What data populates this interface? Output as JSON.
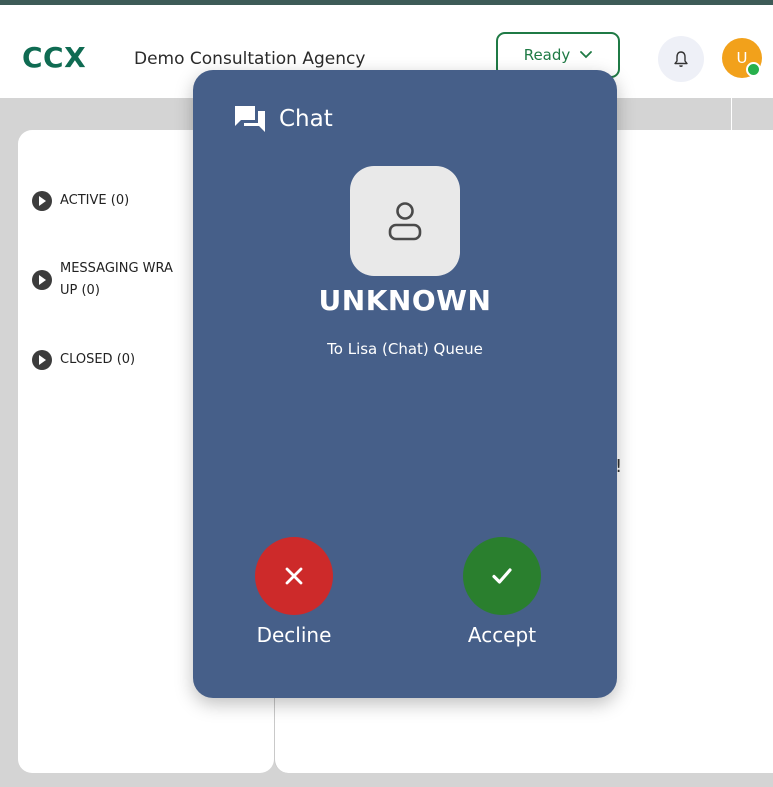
{
  "header": {
    "logo": "CCX",
    "agency_name": "Demo Consultation Agency",
    "status": {
      "label": "Ready",
      "icon": "chevron-down-icon"
    },
    "notifications_icon": "bell-icon",
    "avatar_initial": "U",
    "colors": {
      "logo": "#0f6b52",
      "status": "#1f7a45",
      "avatar": "#f2a11b",
      "presence": "#27b04c"
    }
  },
  "sidebar": {
    "items": [
      {
        "label": "ACTIVE (0)"
      },
      {
        "label": "MESSAGING WRA",
        "label2": "UP (0)"
      },
      {
        "label": "CLOSED (0)"
      }
    ]
  },
  "main": {
    "partial_text": "!"
  },
  "incoming": {
    "title": "Chat",
    "title_icon": "chat-bubbles-icon",
    "avatar_icon": "person-icon",
    "caller": "UNKNOWN",
    "queue": "To Lisa (Chat) Queue",
    "decline_label": "Decline",
    "accept_label": "Accept",
    "colors": {
      "modal": "#465f89",
      "decline": "#cd2a2a",
      "accept": "#2a7f2e"
    }
  }
}
